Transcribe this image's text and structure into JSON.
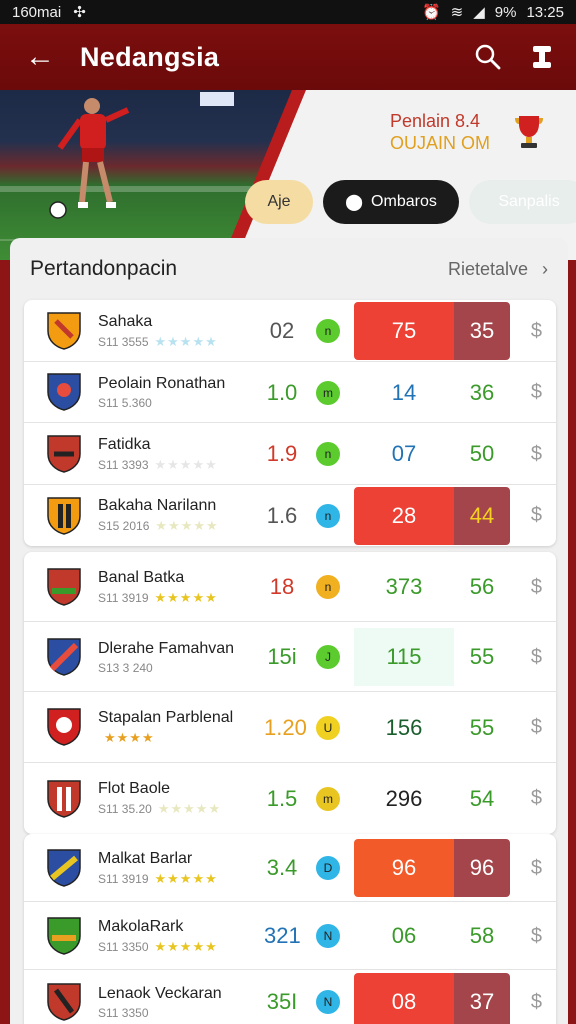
{
  "status": {
    "left": "160mai",
    "right_pct": "9%",
    "time": "13:25"
  },
  "appbar": {
    "title": "Nedangsia"
  },
  "hero": {
    "line1": "Penlain  8.4",
    "line2": "OUJAIN  OM"
  },
  "chips": [
    {
      "label": "Aje"
    },
    {
      "label": "Ombaros"
    },
    {
      "label": "Sanpalis"
    }
  ],
  "panel": {
    "title": "Pertandonpacin",
    "link": "Rietetalve"
  },
  "colors": {
    "primary": "#7c0e0e",
    "hot": "#ec4134",
    "hot_dark": "#a3454a",
    "green": "#2e9a2e"
  },
  "groups": [
    {
      "rows": [
        {
          "name": "Sahaka",
          "code": "S11 3555",
          "stars": "★★★★★",
          "odd": "02",
          "dot": "n",
          "v1": "75",
          "v2": "35"
        },
        {
          "name": "Peolain Ronathan",
          "code": "S11 5.360",
          "stars": "",
          "odd": "1.0",
          "dot": "m",
          "v1": "14",
          "v2": "36"
        },
        {
          "name": "Fatidka",
          "code": "S11 3393",
          "stars": "★★★★★",
          "odd": "1.9",
          "dot": "n",
          "v1": "07",
          "v2": "50"
        },
        {
          "name": "Bakaha Narilann",
          "code": "S15 2016",
          "stars": "★★★★★",
          "odd": "1.6",
          "dot": "n",
          "v1": "28",
          "v2": "44"
        }
      ]
    },
    {
      "rows": [
        {
          "name": "Banal Batka",
          "code": "S11 3919",
          "stars": "★★★★★",
          "odd": "18",
          "dot": "n",
          "v1": "373",
          "v2": "56"
        },
        {
          "name": "Dlerahe Famahvan",
          "code": "S13 3 240",
          "stars": "",
          "odd": "15i",
          "dot": "J",
          "v1": "115",
          "v2": "55"
        },
        {
          "name": "Stapalan Parblenal",
          "code": "",
          "stars": "★★★★",
          "odd": "1.20",
          "dot": "U",
          "v1": "156",
          "v2": "55"
        },
        {
          "name": "Flot Baole",
          "code": "S11 35.20",
          "stars": "★★★★★",
          "odd": "1.5",
          "dot": "m",
          "v1": "296",
          "v2": "54"
        }
      ]
    },
    {
      "rows": [
        {
          "name": "Malkat Barlar",
          "code": "S11 3919",
          "stars": "★★★★★",
          "odd": "3.4",
          "dot": "D",
          "v1": "96",
          "v2": "96"
        },
        {
          "name": "MakolaRark",
          "code": "S11 3350",
          "stars": "★★★★★",
          "odd": "321",
          "dot": "N",
          "v1": "06",
          "v2": "58"
        },
        {
          "name": "Lenaok Veckaran",
          "code": "S11 3350",
          "stars": "",
          "odd": "35I",
          "dot": "N",
          "v1": "08",
          "v2": "37"
        }
      ]
    }
  ]
}
